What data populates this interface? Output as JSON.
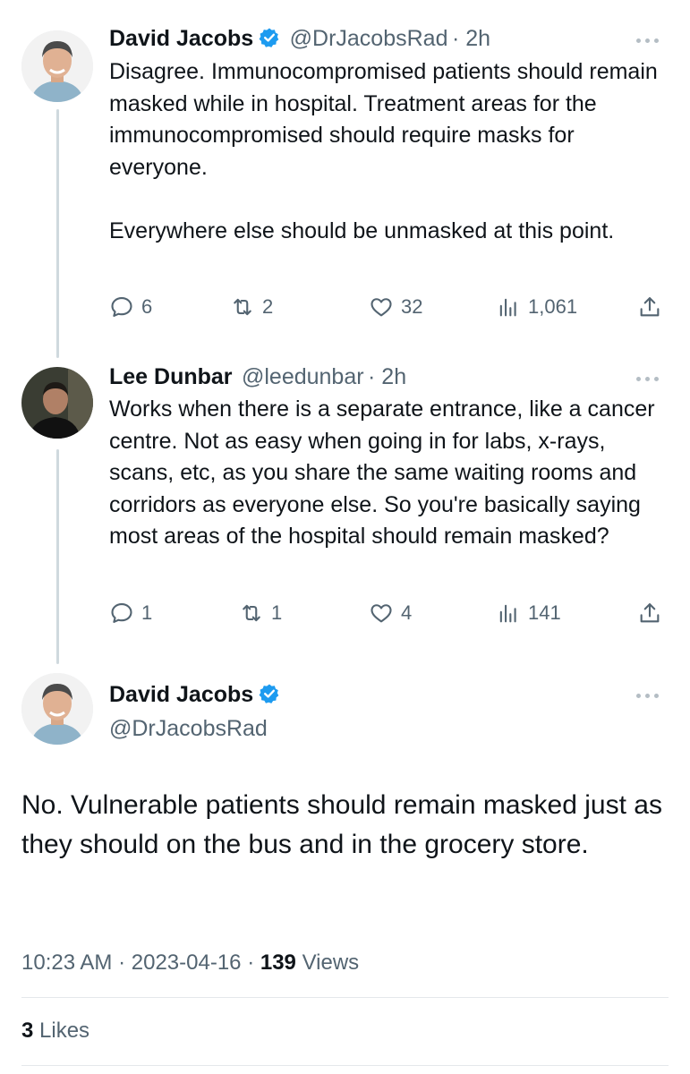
{
  "tweets": [
    {
      "name": "David Jacobs",
      "handle": "@DrJacobsRad",
      "time": "· 2h",
      "text": "Disagree. Immunocompromised patients should remain masked while in hospital. Treatment areas for the immunocompromised should require masks for everyone.\n\nEverywhere else should be unmasked at this point.",
      "replies": "6",
      "retweets": "2",
      "likes": "32",
      "views": "1,061"
    },
    {
      "name": "Lee Dunbar",
      "handle": "@leedunbar",
      "time": "· 2h",
      "text": "Works when there is a separate entrance, like a cancer centre. Not as easy when going in for labs, x-rays, scans, etc, as you share the same waiting rooms and corridors as everyone else. So you're basically saying most areas of the hospital should remain masked?",
      "replies": "1",
      "retweets": "1",
      "likes": "4",
      "views": "141"
    }
  ],
  "main": {
    "name": "David Jacobs",
    "handle": "@DrJacobsRad",
    "text": "No. Vulnerable patients should remain masked just as they should on the bus and in the grocery store.",
    "time": "10:23 AM",
    "date": "2023-04-16",
    "views_count": "139",
    "views_label": "Views",
    "likes_count": "3",
    "likes_label": "Likes"
  },
  "colors": {
    "verified": "#1d9bf0",
    "muted": "#536471",
    "thread_line": "#cfd9de"
  },
  "icons": [
    "verified-badge-icon",
    "more-icon",
    "reply-icon",
    "retweet-icon",
    "like-icon",
    "views-icon",
    "share-icon"
  ]
}
